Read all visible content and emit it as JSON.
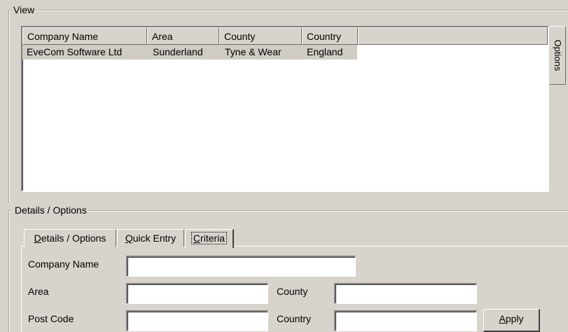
{
  "view_group": {
    "title": "View",
    "list": {
      "columns": [
        "Company Name",
        "Area",
        "County",
        "Country"
      ],
      "rows": [
        [
          "EveCom Software Ltd",
          "Sunderland",
          "Tyne & Wear",
          "England"
        ]
      ]
    },
    "options_tab": "Options"
  },
  "details_group": {
    "title": "Details / Options",
    "tabs": [
      {
        "label": "Details / Options",
        "underline": "D",
        "rest": "etails / Options"
      },
      {
        "label": "Quick Entry",
        "underline": "Q",
        "rest": "uick Entry"
      },
      {
        "label": "Criteria",
        "underline": "C",
        "rest": "riteria",
        "active": true
      }
    ],
    "criteria": {
      "company_name_label": "Company Name",
      "company_name_value": "",
      "area_label": "Area",
      "area_value": "",
      "county_label": "County",
      "county_value": "",
      "post_code_label": "Post Code",
      "post_code_value": "",
      "country_label": "Country",
      "country_value": "",
      "apply_button": {
        "underline": "A",
        "rest": "pply"
      }
    }
  }
}
